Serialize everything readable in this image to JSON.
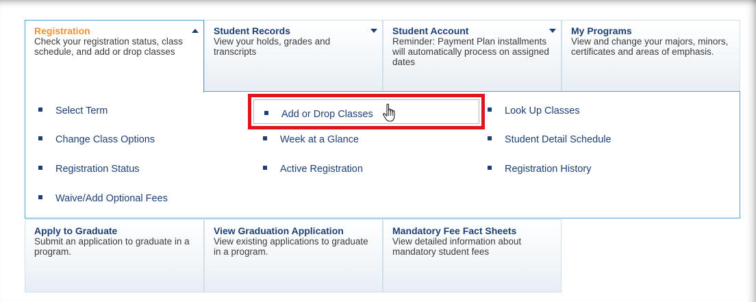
{
  "tiles": {
    "registration": {
      "title": "Registration",
      "desc": "Check your registration status, class schedule, and add or drop classes"
    },
    "student_records": {
      "title": "Student Records",
      "desc": "View your holds, grades and transcripts"
    },
    "student_account": {
      "title": "Student Account",
      "desc": "Reminder: Payment Plan installments will automatically process on assigned dates"
    },
    "my_programs": {
      "title": "My Programs",
      "desc": "View and change your majors, minors, certificates and areas of emphasis."
    },
    "apply_graduate": {
      "title": "Apply to Graduate",
      "desc": "Submit an application to graduate in a program."
    },
    "view_grad_app": {
      "title": "View Graduation Application",
      "desc": "View existing applications to graduate in a program."
    },
    "fee_sheets": {
      "title": "Mandatory Fee Fact Sheets",
      "desc": "View detailed information about mandatory student fees"
    }
  },
  "registration_menu": {
    "col1": [
      "Select Term",
      "Change Class Options",
      "Registration Status",
      "Waive/Add Optional Fees"
    ],
    "col2": [
      "Add or Drop Classes",
      "Week at a Glance",
      "Active Registration"
    ],
    "col3": [
      "Look Up Classes",
      "Student Detail Schedule",
      "Registration History"
    ]
  },
  "icons": {
    "expanded_arrow": "triangle-up-icon",
    "collapsed_arrow": "triangle-down-icon",
    "cursor": "hand-pointer-icon",
    "bullet": "square-bullet-icon"
  },
  "colors": {
    "link": "#1c3f74",
    "active_title": "#f2902e",
    "panel_border": "#4aa3d8",
    "highlight": "#e0141e"
  }
}
